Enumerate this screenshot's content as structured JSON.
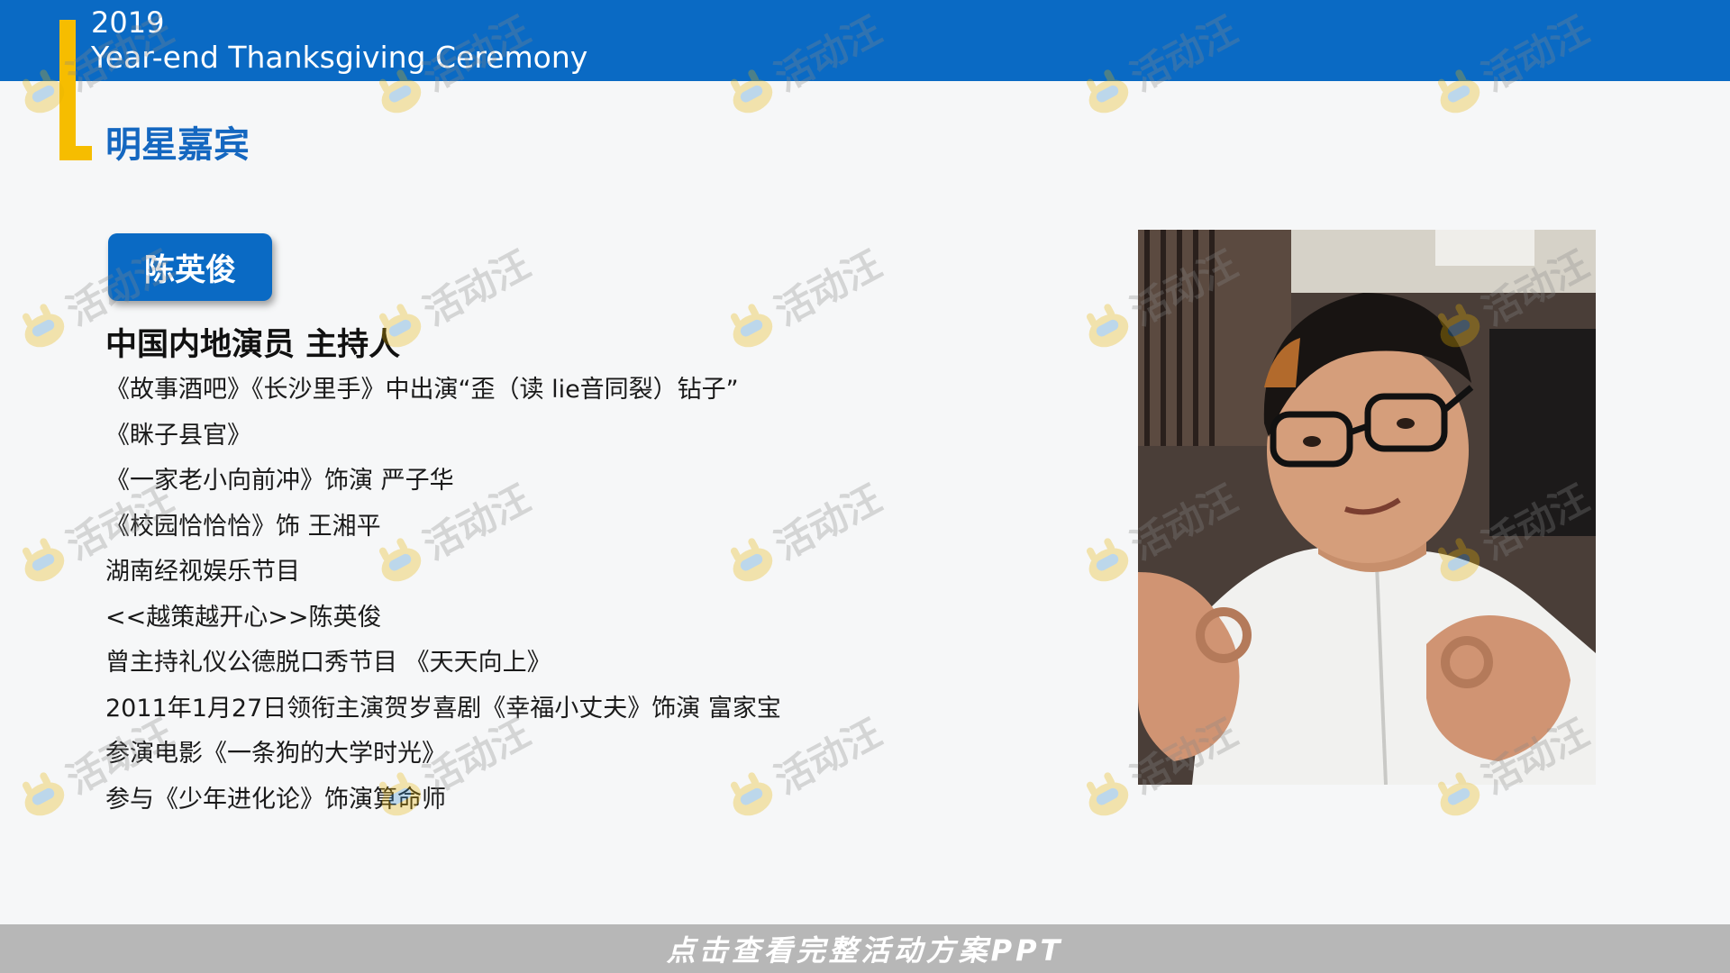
{
  "header": {
    "year": "2019",
    "title": "Year-end Thanksgiving Ceremony"
  },
  "section": {
    "title": "明星嘉宾"
  },
  "guest": {
    "name": "陈英俊",
    "role": "中国内地演员 主持人",
    "bio": [
      "《故事酒吧》《长沙里手》中出演“歪（读 lie音同裂）钻子”",
      "《眯子县官》",
      "《一家老小向前冲》饰演 严子华",
      "《校园恰恰恰》饰 王湘平",
      "湖南经视娱乐节目",
      "<<越策越开心>>陈英俊",
      "曾主持礼仪公德脱口秀节目 《天天向上》",
      "2011年1月27日领衔主演贺岁喜剧《幸福小丈夫》饰演 富家宝",
      "参演电影《一条狗的大学时光》",
      "参与《少年进化论》饰演算命师"
    ]
  },
  "watermark": {
    "text": "活动汪"
  },
  "footer": {
    "cta": "点击查看完整活动方案PPT"
  },
  "colors": {
    "header_blue": "#0a6ac4",
    "accent_yellow": "#f6bd00",
    "footer_gray": "#b7b7b7"
  }
}
